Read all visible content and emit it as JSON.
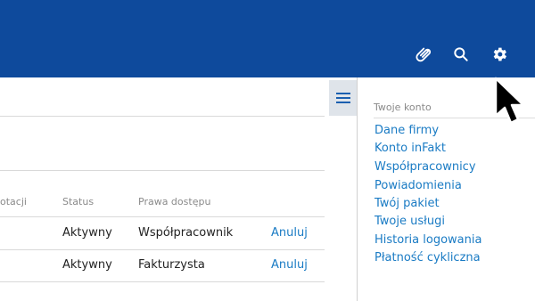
{
  "header": {
    "icons": [
      "paperclip-icon",
      "search-icon",
      "gear-icon"
    ],
    "background": "#0e4a9c"
  },
  "table": {
    "headers": {
      "partial_first": "otacji",
      "status": "Status",
      "rights": "Prawa dostępu"
    },
    "rows": [
      {
        "status": "Aktywny",
        "rights": "Współpracownik",
        "action": "Anuluj"
      },
      {
        "status": "Aktywny",
        "rights": "Fakturzysta",
        "action": "Anuluj"
      }
    ]
  },
  "panel": {
    "title": "Twoje konto",
    "items": [
      "Dane firmy",
      "Konto inFakt",
      "Współpracownicy",
      "Powiadomienia",
      "Twój pakiet",
      "Twoje usługi",
      "Historia logowania",
      "Płatność cykliczna"
    ]
  },
  "colors": {
    "link": "#1a7bc4",
    "muted": "#8a8a8a"
  }
}
